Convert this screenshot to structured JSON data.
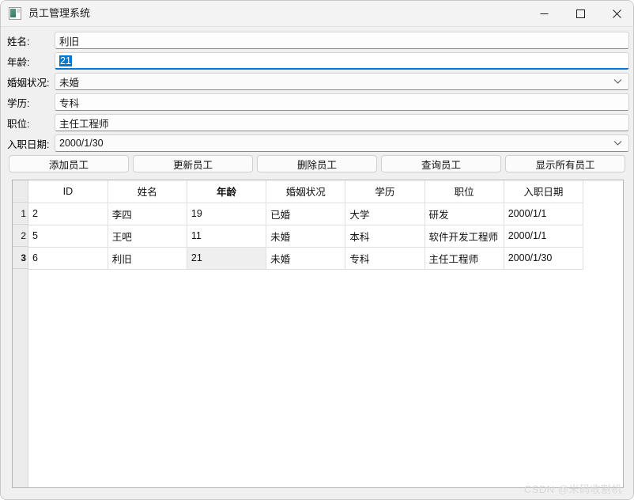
{
  "window": {
    "title": "员工管理系统",
    "icon": "app-window-icon",
    "controls": {
      "minimize": "minimize-icon",
      "maximize": "maximize-icon",
      "close": "close-icon"
    }
  },
  "form": {
    "fields": [
      {
        "label": "姓名:",
        "value": "利旧",
        "type": "text",
        "name": "name",
        "focused": false,
        "selected": false
      },
      {
        "label": "年龄:",
        "value": "21",
        "type": "text",
        "name": "age",
        "focused": true,
        "selected": true
      },
      {
        "label": "婚姻状况:",
        "value": "未婚",
        "type": "combobox",
        "name": "marital-status",
        "focused": false,
        "selected": false
      },
      {
        "label": "学历:",
        "value": "专科",
        "type": "text",
        "name": "education",
        "focused": false,
        "selected": false
      },
      {
        "label": "职位:",
        "value": "主任工程师",
        "type": "text",
        "name": "position",
        "focused": false,
        "selected": false
      },
      {
        "label": "入职日期:",
        "value": "2000/1/30",
        "type": "datepicker",
        "name": "hire-date",
        "focused": false,
        "selected": false
      }
    ]
  },
  "toolbar": {
    "buttons": [
      {
        "label": "添加员工",
        "name": "add-employee"
      },
      {
        "label": "更新员工",
        "name": "update-employee"
      },
      {
        "label": "删除员工",
        "name": "delete-employee"
      },
      {
        "label": "查询员工",
        "name": "query-employee"
      },
      {
        "label": "显示所有员工",
        "name": "show-all-employees"
      }
    ]
  },
  "grid": {
    "columns": [
      "ID",
      "姓名",
      "年龄",
      "婚姻状况",
      "学历",
      "职位",
      "入职日期"
    ],
    "selected_column_index": 2,
    "current_row_index": 2,
    "current_cell_column_index": 2,
    "row_numbers": [
      "1",
      "2",
      "3"
    ],
    "rows": [
      [
        "2",
        "李四",
        "19",
        "已婚",
        "大学",
        "研发",
        "2000/1/1"
      ],
      [
        "5",
        "王吧",
        "11",
        "未婚",
        "本科",
        "软件开发工程师",
        "2000/1/1"
      ],
      [
        "6",
        "利旧",
        "21",
        "未婚",
        "专科",
        "主任工程师",
        "2000/1/30"
      ]
    ]
  },
  "watermark": {
    "text": "CSDN @米码收割机"
  },
  "colors": {
    "accent": "#0078d4",
    "window_bg": "#f0f0f0",
    "titlebar_bg": "#f3f3f3",
    "grid_bg": "#ffffff",
    "current_cell_bg": "#efefef"
  }
}
